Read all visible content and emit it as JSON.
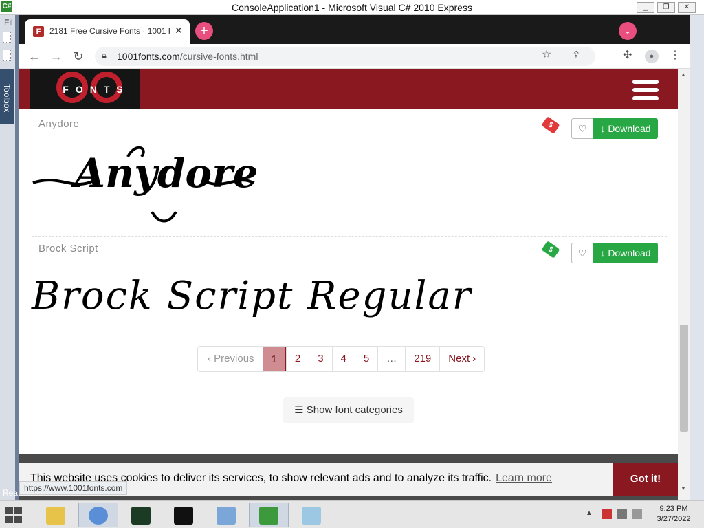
{
  "vs": {
    "title": "ConsoleApplication1 - Microsoft Visual C# 2010 Express",
    "app_icon_label": "C#",
    "menu_file": "Fil",
    "toolbox_label": "Toolbox",
    "status": "Rea",
    "controls": {
      "minimize": "▁",
      "restore": "❐",
      "close": "✕"
    }
  },
  "browser": {
    "tab": {
      "favicon": "F",
      "title": "2181 Free Cursive Fonts · 1001 Fo",
      "close": "✕"
    },
    "new_tab": "+",
    "tab_search": "⌄",
    "nav": {
      "back": "←",
      "forward": "→",
      "reload": "↻"
    },
    "url_host": "1001fonts.com",
    "url_path": "/cursive-fonts.html",
    "status_tip": "https://www.1001fonts.com"
  },
  "site": {
    "logo_text": "FONTS",
    "fonts": [
      {
        "name": "Anydore",
        "preview": "Anydore",
        "tag_color": "#e03a3a",
        "download_label": "Download"
      },
      {
        "name": "Brock Script",
        "preview": "Brock Script Regular",
        "tag_color": "#28a745",
        "download_label": "Download"
      }
    ],
    "pagination": {
      "previous": "Previous",
      "pages": [
        "1",
        "2",
        "3",
        "4",
        "5",
        "…",
        "219"
      ],
      "active_page": "1",
      "next": "Next"
    },
    "show_categories": "Show font categories",
    "cookie": {
      "text": "This website uses cookies to deliver its services, to show relevant ads and to analyze its traffic.",
      "link": "Learn more",
      "button": "Got it!"
    }
  },
  "taskbar": {
    "time": "9:23 PM",
    "date": "3/27/2022"
  },
  "colors": {
    "brand_red": "#8a1821",
    "download_green": "#28a745",
    "chrome_accent": "#e84f7e"
  }
}
